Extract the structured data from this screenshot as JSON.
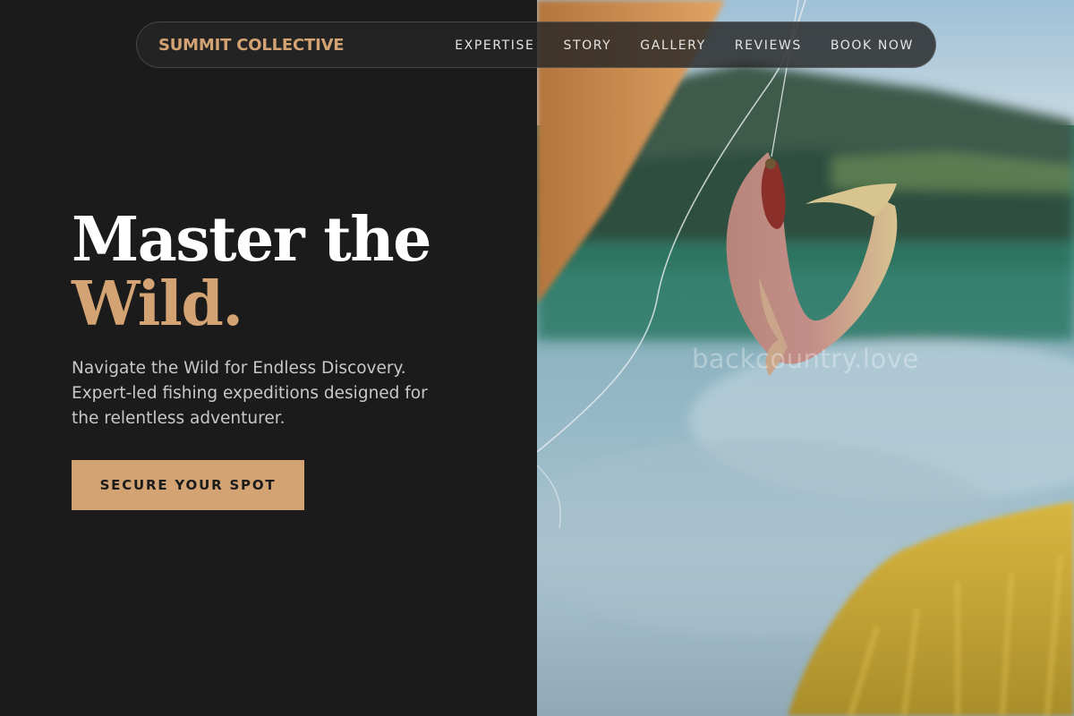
{
  "nav": {
    "brand": "SUMMIT COLLECTIVE",
    "links": [
      "EXPERTISE",
      "STORY",
      "GALLERY",
      "REVIEWS",
      "BOOK NOW"
    ]
  },
  "hero": {
    "headline_line1": "Master the",
    "headline_line2": "Wild.",
    "subcopy_lines": [
      "Navigate the Wild for Endless Discovery.",
      "Expert-led fishing expeditions designed for",
      "the relentless adventurer."
    ],
    "cta_label": "SECURE YOUR SPOT"
  },
  "photo": {
    "watermark": "backcountry.love"
  },
  "colors": {
    "accent": "#d4a373",
    "background": "#1a1b1a",
    "text_light": "#ffffff",
    "text_muted": "#c8c8c8"
  }
}
